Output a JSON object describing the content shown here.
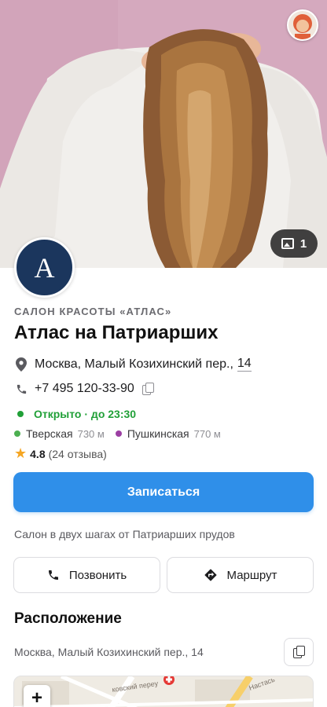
{
  "hero": {
    "photo_count": "1"
  },
  "venue": {
    "logo_letter": "A",
    "category": "САЛОН КРАСОТЫ «АТЛАС»",
    "name": "Атлас на Патриарших",
    "address_main": "Москва, Малый Козихинский пер.,",
    "address_num": "14",
    "phone": "+7 495 120-33-90",
    "open_status": "Открыто · до 23:30",
    "metro": [
      {
        "name": "Тверская",
        "distance": "730 м",
        "color": "#4caf50"
      },
      {
        "name": "Пушкинская",
        "distance": "770 м",
        "color": "#9c3fa3"
      }
    ],
    "rating": "4.8",
    "reviews": "(24 отзыва)",
    "description": "Салон в двух шагах от Патриарших прудов"
  },
  "actions": {
    "book_label": "Записаться",
    "call_label": "Позвонить",
    "route_label": "Маршрут"
  },
  "location": {
    "title": "Расположение",
    "address": "Москва, Малый Козихинский пер., 14",
    "map_street_label": "ковский переу",
    "map_street_label_2": "Настась",
    "zoom_in": "+"
  },
  "colors": {
    "accent": "#2f8fe9",
    "open": "#21a038",
    "logo_bg": "#1b365d",
    "star": "#f5a623"
  },
  "icons": [
    "image-icon",
    "location-pin-icon",
    "phone-icon",
    "copy-icon",
    "star-icon",
    "route-icon"
  ]
}
